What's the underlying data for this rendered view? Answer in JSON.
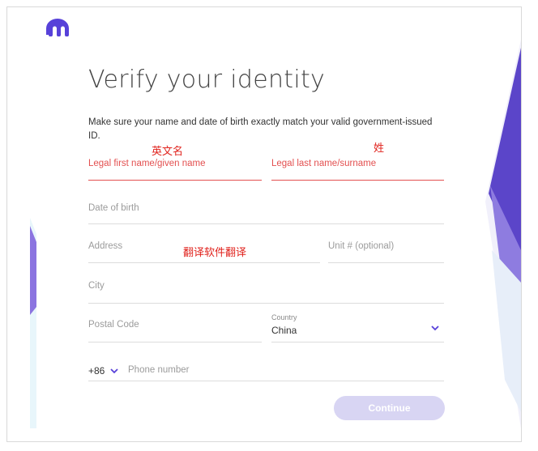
{
  "page": {
    "title": "Verify your identity",
    "subtitle": "Make sure your name and date of birth exactly match your valid government-issued ID."
  },
  "annotations": {
    "first_name_note": "英文名",
    "last_name_note": "姓",
    "address_note": "翻译软件翻译"
  },
  "form": {
    "first_name": {
      "label": "Legal first name/given name",
      "value": ""
    },
    "last_name": {
      "label": "Legal last name/surname",
      "value": ""
    },
    "dob": {
      "placeholder": "Date of birth"
    },
    "address": {
      "placeholder": "Address"
    },
    "unit": {
      "placeholder": "Unit # (optional)"
    },
    "city": {
      "placeholder": "City"
    },
    "postal": {
      "placeholder": "Postal Code"
    },
    "country": {
      "label": "Country",
      "value": "China"
    },
    "phone": {
      "code": "+86",
      "placeholder": "Phone number"
    },
    "continue_label": "Continue"
  },
  "icons": {
    "logo": "kraken-logo-icon",
    "country_chevron": "chevron-down-icon",
    "phone_chevron": "chevron-down-icon"
  },
  "colors": {
    "brand": "#5741d9",
    "error": "#e35050",
    "annotation": "#e0221c",
    "button_disabled": "#d8d5f3"
  }
}
